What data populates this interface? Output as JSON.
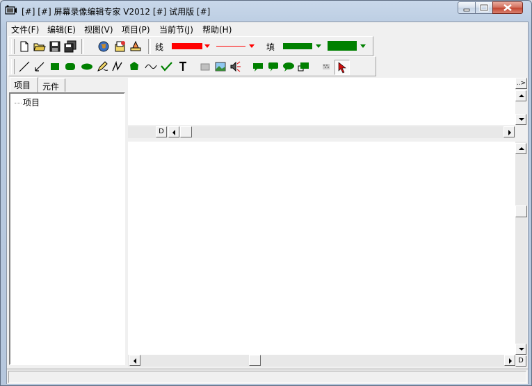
{
  "window": {
    "title": "[#] [#] 屏幕录像编辑专家 V2012 [#] 试用版 [#]"
  },
  "menu": [
    {
      "label": "文件(F)"
    },
    {
      "label": "编辑(E)"
    },
    {
      "label": "视图(V)"
    },
    {
      "label": "项目(P)"
    },
    {
      "label": "当前节(J)"
    },
    {
      "label": "帮助(H)"
    }
  ],
  "toolbar": {
    "line_label": "线",
    "fill_label": "填",
    "line_color": "#ff0000",
    "line_style_color": "#ff0000",
    "fill_color": "#008000",
    "fill_color_2": "#008000",
    "file_buttons": [
      "new-file-icon",
      "open-folder-icon",
      "save-icon",
      "save-all-icon"
    ],
    "project_buttons": [
      "globe-icon",
      "export-icon",
      "publish-icon"
    ],
    "draw_tools": [
      "line-icon",
      "arrow-icon",
      "rectangle-icon",
      "rounded-rect-icon",
      "ellipse-icon",
      "pencil-icon",
      "freehand-icon",
      "polygon-icon",
      "curve-icon",
      "check-icon",
      "text-icon",
      "gray-rect-icon",
      "image-icon",
      "sound-icon",
      "callout-rect-icon",
      "callout-round-icon",
      "callout-oval-icon",
      "callout-cloud-icon",
      "mosaic-icon",
      "pointer-icon"
    ]
  },
  "panel": {
    "tabs": [
      {
        "label": "项目"
      },
      {
        "label": "元件"
      }
    ],
    "tree_root": "项目"
  },
  "top_pane": {
    "expand_label": "..>",
    "d_label": "D"
  },
  "bottom_pane": {
    "d_label": "D"
  },
  "status": {
    "text": ""
  }
}
